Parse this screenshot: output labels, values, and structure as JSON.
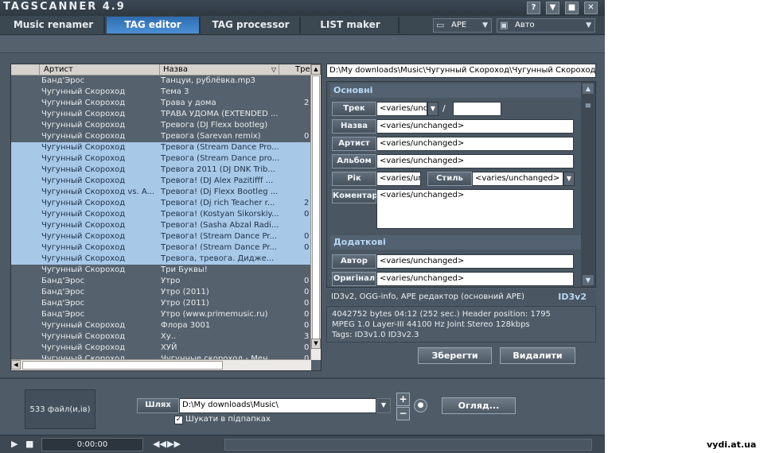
{
  "app": {
    "title": "TAGSCANNER 4.9"
  },
  "window_buttons": [
    "?",
    "▼",
    "■",
    "✕"
  ],
  "tabs": [
    {
      "label": "Music renamer"
    },
    {
      "label": "TAG editor"
    },
    {
      "label": "TAG processor"
    },
    {
      "label": "LIST maker"
    }
  ],
  "format_combo": {
    "value": "APE"
  },
  "mode_combo": {
    "value": "Авто"
  },
  "list": {
    "columns": [
      "Артист",
      "Назва",
      "Тре"
    ],
    "rows": [
      {
        "artist": "Банд'Эрос",
        "title": "Танцуи, рублёвка.mp3",
        "track": "",
        "selected": false
      },
      {
        "artist": "Чугунный Скороход",
        "title": "Тема 3",
        "track": "",
        "selected": false
      },
      {
        "artist": "Чугунный Скороход",
        "title": "Трава у дома",
        "track": "2",
        "selected": false
      },
      {
        "artist": "Чугунный Скороход",
        "title": "ТРАВА УДОМА (EXTENDED ...",
        "track": "",
        "selected": false
      },
      {
        "artist": "Чугунный Скороход",
        "title": "Тревога (DJ Flexx bootleg)",
        "track": "",
        "selected": false
      },
      {
        "artist": "Чугунный Скороход",
        "title": "Тревога (Sarevan remix)",
        "track": "0",
        "selected": false
      },
      {
        "artist": "Чугунный Скороход",
        "title": "Тревога (Stream Dance Pro...",
        "track": "",
        "selected": true
      },
      {
        "artist": "Чугунный Скороход",
        "title": "Тревога (Stream Dance pro...",
        "track": "",
        "selected": true
      },
      {
        "artist": "Чугунный Скороход",
        "title": "Тревога 2011 (DJ DNK Trib...",
        "track": "",
        "selected": true
      },
      {
        "artist": "Чугунный Скороход",
        "title": "Тревога! (DJ Alex Pazitifff ...",
        "track": "",
        "selected": true
      },
      {
        "artist": "Чугунный Скороход vs. A...",
        "title": "Тревога! (Dj Flexx Bootleg ...",
        "track": "",
        "selected": true
      },
      {
        "artist": "Чугунный Скороход",
        "title": "Тревога! (Dj rich Teacher r...",
        "track": "2",
        "selected": true
      },
      {
        "artist": "Чугунный Скороход",
        "title": "Тревога! (Kostyan Sikorskiy...",
        "track": "0",
        "selected": true
      },
      {
        "artist": "Чугунный Скороход",
        "title": "Тревога! (Sasha Abzal Radi...",
        "track": "",
        "selected": true
      },
      {
        "artist": "Чугунный Скороход",
        "title": "Тревога! (Stream Dance Pr...",
        "track": "0",
        "selected": true
      },
      {
        "artist": "Чугунный Скороход",
        "title": "Тревога! (Stream Dance Pr...",
        "track": "0",
        "selected": true
      },
      {
        "artist": "Чугунный Скороход",
        "title": "Тревога, тревога. Дидже...",
        "track": "",
        "selected": true
      },
      {
        "artist": "Чугунный Скороход",
        "title": "Три Буквы!",
        "track": "",
        "selected": false
      },
      {
        "artist": "Банд'Эрос",
        "title": "Утро",
        "track": "0",
        "selected": false
      },
      {
        "artist": "Банд'Эрос",
        "title": "Утро (2011)",
        "track": "0",
        "selected": false
      },
      {
        "artist": "Банд'Эрос",
        "title": "Утро (2011)",
        "track": "0",
        "selected": false
      },
      {
        "artist": "Банд'Эрос",
        "title": "Утро (www.primemusic.ru)",
        "track": "0",
        "selected": false
      },
      {
        "artist": "Чугунный Скороход",
        "title": "Флора 3001",
        "track": "0",
        "selected": false
      },
      {
        "artist": "Чугунный Скороход",
        "title": "Ху..",
        "track": "3",
        "selected": false
      },
      {
        "artist": "Чугунный Скороход",
        "title": "ХУЙ",
        "track": "0",
        "selected": false
      },
      {
        "artist": "Чугунный Скороход",
        "title": "Чугунные скороход - Мен...",
        "track": "0",
        "selected": false
      }
    ]
  },
  "path_display": "D:\\My downloads\\Music\\Чугунный Скороход\\Чугунный Скороход",
  "tag_editor": {
    "section_main": "Основні",
    "section_extra": "Додаткові",
    "track_label": "Трек",
    "track_value": "<varies/unchanged>",
    "track_sep": "/",
    "track_total": "",
    "title_label": "Назва",
    "title_value": "<varies/unchanged>",
    "artist_label": "Артист",
    "artist_value": "<varies/unchanged>",
    "album_label": "Альбом",
    "album_value": "<varies/unchanged>",
    "year_label": "Рік",
    "year_value": "<varies/unchanged>",
    "genre_label": "Стиль",
    "genre_value": "<varies/unchanged>",
    "comment_label": "Коментар",
    "comment_value": "<varies/unchanged>",
    "author_label": "Автор",
    "author_value": "<varies/unchanged>",
    "original_label": "Оригінал",
    "original_value": "<varies/unchanged>"
  },
  "info": {
    "tag_summary": "ID3v2, OGG-info, APE редактор (основний APE)",
    "tag_type": "ID3v2",
    "line1": "4042752 bytes  04:12 (252 sec.)  Header position: 1795",
    "line2": "MPEG 1.0  Layer-III  44100 Hz  Joint Stereo  128kbps",
    "line3": "Tags: ID3v1.0 ID3v2.3"
  },
  "buttons": {
    "save": "Зберегти",
    "delete": "Видалити",
    "browse": "Огляд..."
  },
  "file_count": "533 файл(и,ів)",
  "path_label": "Шлях",
  "path_value": "D:\\My downloads\\Music\\",
  "subfolders_label": "Шукати в підпапках",
  "player": {
    "time": "0:00:00"
  },
  "watermark": "vydi.at.ua"
}
